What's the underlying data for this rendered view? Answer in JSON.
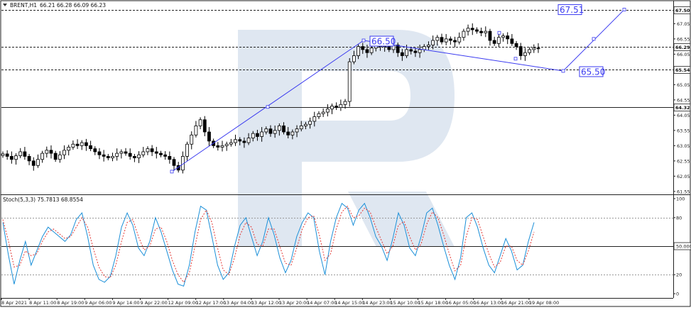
{
  "header": {
    "symbol_label": "BRENT,H1",
    "ohlc_label": "66.21 66.28 66.09 66.23"
  },
  "indicator": {
    "label": "Stoch(5,3,3) 75.7813 68.8554"
  },
  "annotations": {
    "target_high": "67.51",
    "pivot_high": "66.50",
    "target_low": "65.50"
  },
  "colors": {
    "main_line": "#1a8fd8",
    "signal_line": "#e53935",
    "forecast_line": "#3a3af0",
    "watermark": "#d9e3ef"
  },
  "chart_data": [
    {
      "type": "candlestick",
      "symbol": "BRENT",
      "timeframe": "H1",
      "ylim": [
        61.5,
        67.5
      ],
      "y_ticks": [
        "67.50",
        "67.05",
        "66.55",
        "66.05",
        "65.55",
        "65.05",
        "64.55",
        "64.05",
        "63.55",
        "63.05",
        "62.55",
        "62.05",
        "61.55"
      ],
      "x_ticks": [
        "8 Apr 2021",
        "8 Apr 11:00",
        "8 Apr 19:00",
        "9 Apr 06:00",
        "9 Apr 14:00",
        "9 Apr 22:00",
        "12 Apr 09:00",
        "12 Apr 17:00",
        "13 Apr 04:00",
        "13 Apr 12:00",
        "13 Apr 20:00",
        "14 Apr 07:00",
        "14 Apr 15:00",
        "14 Apr 23:00",
        "15 Apr 10:00",
        "15 Apr 18:00",
        "16 Apr 05:00",
        "16 Apr 13:00",
        "16 Apr 21:00",
        "19 Apr 08:00"
      ],
      "price_levels": [
        {
          "value": 67.5,
          "label": "67.50",
          "style": "dashed"
        },
        {
          "value": 66.29,
          "label": "66.29",
          "style": "dashed"
        },
        {
          "value": 65.54,
          "label": "65.54",
          "style": "dashed"
        },
        {
          "value": 64.32,
          "label": "64.32",
          "style": "solid"
        }
      ],
      "closes": [
        62.78,
        62.7,
        62.6,
        62.72,
        62.85,
        62.7,
        62.55,
        62.4,
        62.6,
        62.8,
        62.9,
        62.8,
        62.6,
        62.75,
        62.9,
        63.0,
        63.1,
        63.05,
        63.15,
        63.05,
        62.95,
        62.85,
        62.75,
        62.7,
        62.65,
        62.7,
        62.8,
        62.85,
        62.8,
        62.7,
        62.65,
        62.75,
        62.85,
        62.95,
        62.85,
        62.8,
        62.75,
        62.7,
        62.6,
        62.4,
        62.25,
        62.7,
        63.1,
        63.4,
        63.7,
        63.9,
        63.5,
        63.2,
        63.05,
        63.0,
        63.05,
        63.1,
        63.15,
        63.25,
        63.2,
        63.15,
        63.3,
        63.45,
        63.35,
        63.5,
        63.6,
        63.45,
        63.55,
        63.7,
        63.5,
        63.4,
        63.5,
        63.6,
        63.7,
        63.75,
        63.85,
        64.0,
        64.1,
        64.15,
        64.25,
        64.35,
        64.3,
        64.4,
        64.5,
        65.8,
        66.0,
        66.3,
        66.2,
        66.1,
        66.25,
        66.4,
        66.3,
        66.45,
        66.2,
        66.35,
        66.1,
        66.0,
        66.2,
        66.15,
        66.1,
        66.2,
        66.3,
        66.35,
        66.5,
        66.6,
        66.45,
        66.55,
        66.5,
        66.45,
        66.6,
        66.8,
        66.9,
        66.85,
        66.8,
        66.75,
        66.8,
        66.5,
        66.4,
        66.6,
        66.65,
        66.55,
        66.4,
        66.3,
        66.0,
        66.1,
        66.2,
        66.25,
        66.23
      ],
      "forecast_path": [
        {
          "x": "12 Apr 09:00",
          "y": 62.2
        },
        {
          "x": "14 Apr 23:00",
          "y": 66.5
        },
        {
          "x": "19 Apr 08:00",
          "y": 65.5
        },
        {
          "x": "19 Apr 08:00+",
          "y": 67.51
        }
      ]
    },
    {
      "type": "line",
      "title": "Stoch(5,3,3) 75.7813 68.8554",
      "ylim": [
        0,
        100
      ],
      "y_ticks": [
        "100",
        "80",
        "50.0000",
        "20",
        "0"
      ],
      "levels": [
        80,
        50,
        20
      ],
      "series": [
        {
          "values": [
            75,
            40,
            10,
            35,
            55,
            30,
            45,
            60,
            70,
            65,
            60,
            55,
            62,
            78,
            85,
            60,
            30,
            15,
            12,
            18,
            40,
            70,
            85,
            72,
            48,
            40,
            55,
            80,
            65,
            45,
            25,
            10,
            8,
            30,
            65,
            92,
            88,
            60,
            30,
            15,
            22,
            50,
            72,
            80,
            60,
            40,
            55,
            80,
            62,
            38,
            22,
            35,
            60,
            75,
            85,
            80,
            45,
            20,
            55,
            80,
            95,
            90,
            72,
            88,
            95,
            80,
            60,
            50,
            35,
            58,
            85,
            72,
            48,
            40,
            60,
            85,
            90,
            72,
            50,
            30,
            15,
            38,
            80,
            85,
            70,
            48,
            30,
            22,
            40,
            58,
            45,
            25,
            30,
            55,
            75
          ]
        },
        {
          "values": [
            78,
            55,
            28,
            30,
            45,
            40,
            42,
            55,
            65,
            68,
            63,
            58,
            60,
            70,
            80,
            70,
            48,
            28,
            18,
            17,
            30,
            55,
            75,
            78,
            60,
            46,
            50,
            68,
            70,
            55,
            35,
            20,
            12,
            22,
            50,
            78,
            88,
            75,
            48,
            25,
            20,
            38,
            62,
            75,
            70,
            52,
            50,
            68,
            68,
            50,
            32,
            30,
            48,
            68,
            80,
            82,
            62,
            35,
            42,
            68,
            86,
            92,
            80,
            82,
            90,
            86,
            70,
            56,
            42,
            50,
            72,
            76,
            60,
            46,
            52,
            73,
            86,
            80,
            62,
            42,
            24,
            30,
            60,
            80,
            78,
            60,
            42,
            28,
            33,
            50,
            50,
            35,
            30,
            45,
            65
          ]
        }
      ]
    }
  ]
}
